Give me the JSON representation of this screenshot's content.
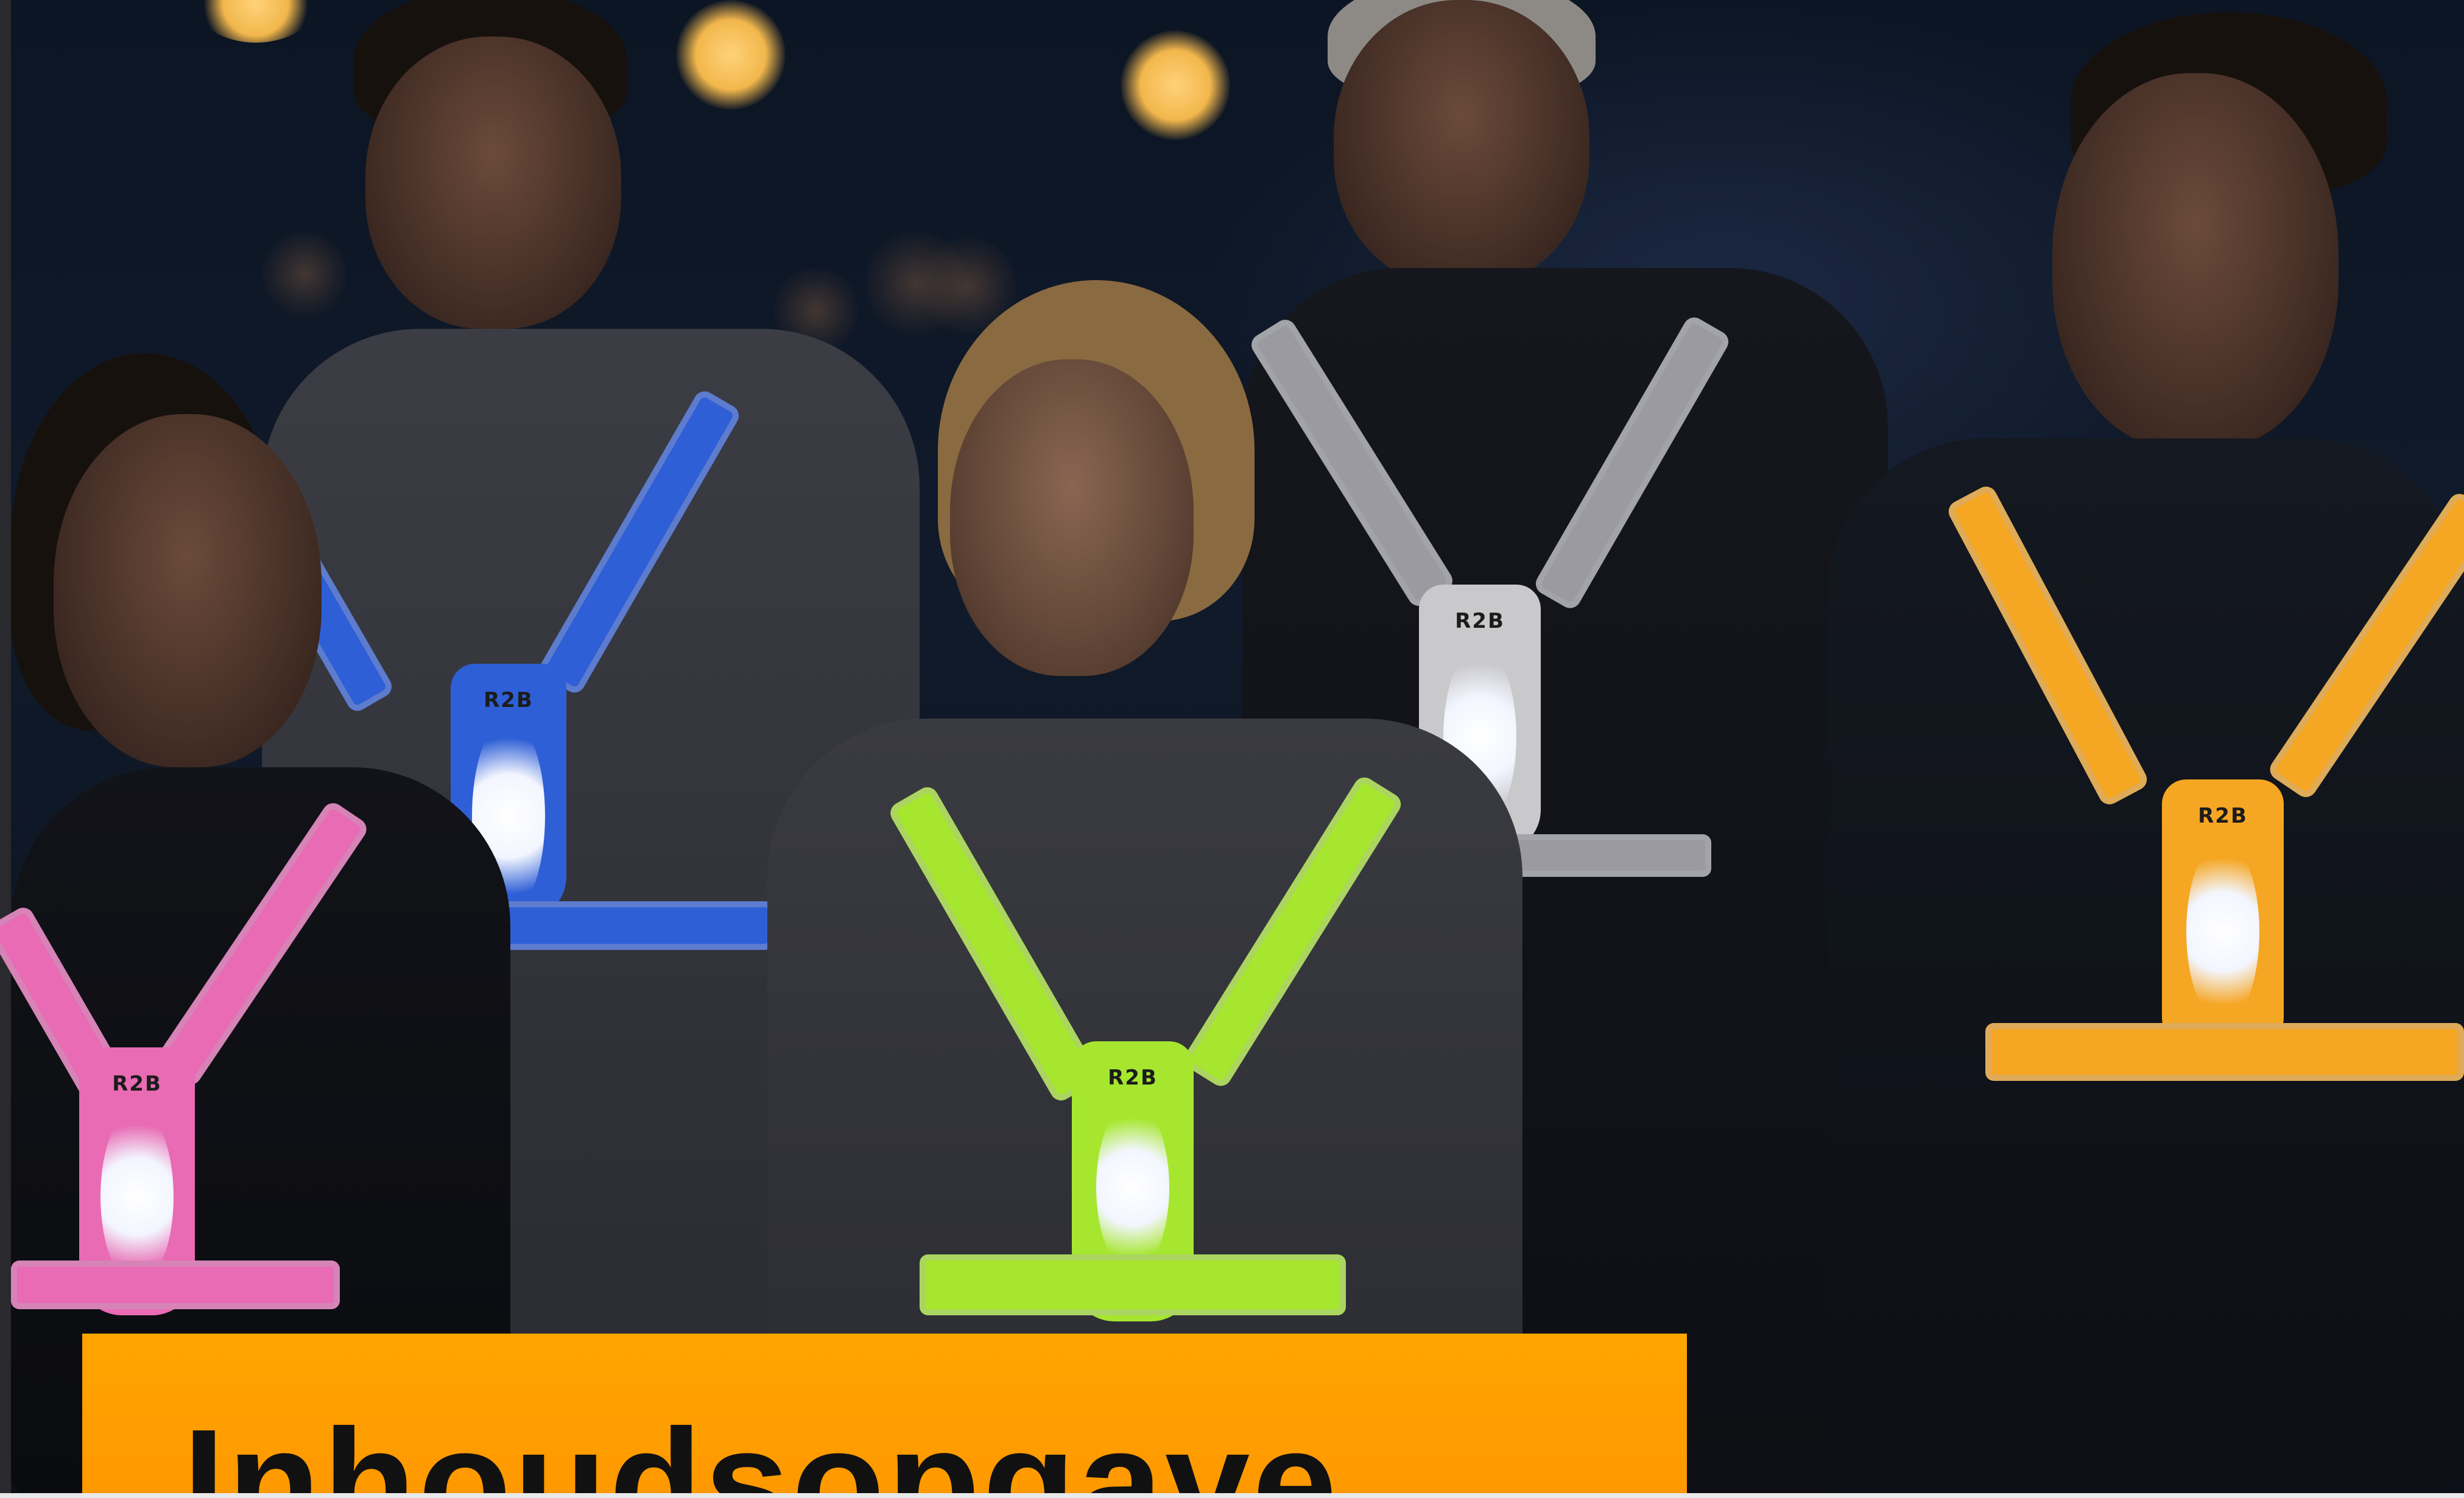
{
  "photo": {
    "people": [
      {
        "id": "woman-left",
        "harness_color": "#e86bb4",
        "brand": "R2B"
      },
      {
        "id": "man-back-left",
        "harness_color": "#2f5fd6",
        "brand": "R2B"
      },
      {
        "id": "woman-center",
        "harness_color": "#a6e62e",
        "brand": "R2B"
      },
      {
        "id": "man-back-right",
        "harness_color": "#9a9aa0",
        "brand": "R2B"
      },
      {
        "id": "man-right",
        "harness_color": "#f5a623",
        "brand": "R2B"
      }
    ]
  },
  "banner": {
    "title": "Inhoudsopgave",
    "color": "#ffa500"
  }
}
